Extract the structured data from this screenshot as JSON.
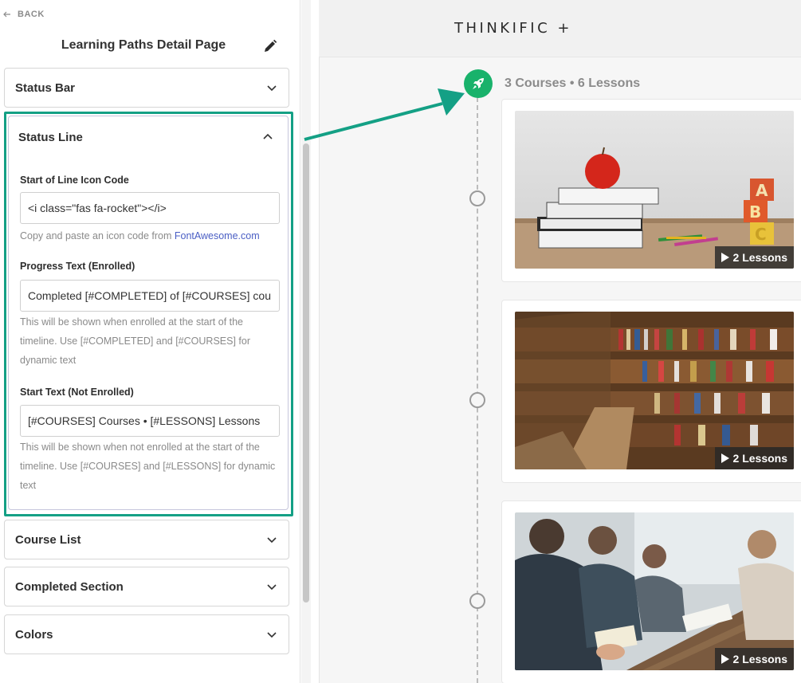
{
  "sidebar": {
    "back_label": "BACK",
    "title": "Learning Paths Detail Page",
    "panels": [
      {
        "label": "Status Bar"
      },
      {
        "label": "Status Line"
      },
      {
        "label": "Course List"
      },
      {
        "label": "Completed Section"
      },
      {
        "label": "Colors"
      }
    ],
    "status_line": {
      "icon_code_label": "Start of Line Icon Code",
      "icon_code_value": "<i class=\"fas fa-rocket\"></i>",
      "icon_help_prefix": "Copy and paste an icon code from ",
      "icon_help_link": "FontAwesome.com",
      "progress_label": "Progress Text (Enrolled)",
      "progress_value": "Completed [#COMPLETED] of [#COURSES] cou",
      "progress_help": "This will be shown when enrolled at the start of the timeline. Use [#COMPLETED] and [#COURSES] for dynamic text",
      "start_label": "Start Text (Not Enrolled)",
      "start_value": "[#COURSES] Courses • [#LESSONS] Lessons",
      "start_help": "This will be shown when not enrolled at the start of the timeline. Use [#COURSES] and [#LESSONS] for dynamic text"
    }
  },
  "preview": {
    "brand": "THINKIFIC +",
    "start_text": "3 Courses • 6 Lessons",
    "courses": [
      {
        "lessons": "2 Lessons"
      },
      {
        "lessons": "2 Lessons"
      },
      {
        "lessons": "2 Lessons"
      }
    ]
  },
  "colors": {
    "highlight": "#14a085",
    "rocket_badge": "#19b26b",
    "link": "#4a5ec4"
  }
}
